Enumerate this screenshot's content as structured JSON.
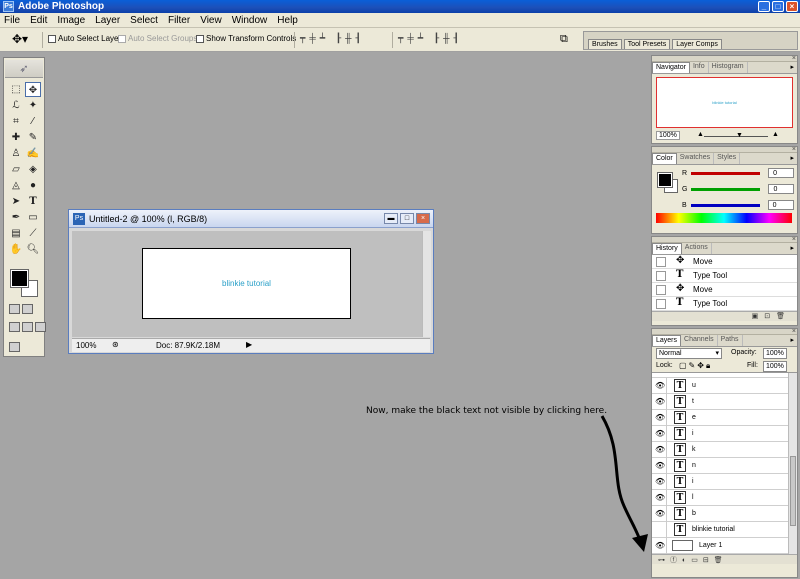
{
  "app": {
    "title": "Adobe Photoshop"
  },
  "menu": [
    "File",
    "Edit",
    "Image",
    "Layer",
    "Select",
    "Filter",
    "View",
    "Window",
    "Help"
  ],
  "options": {
    "auto_select_layer": "Auto Select Layer",
    "auto_select_groups": "Auto Select Groups",
    "show_transform_controls": "Show Transform Controls"
  },
  "well_tabs": [
    "Brushes",
    "Tool Presets",
    "Layer Comps"
  ],
  "document": {
    "title": "Untitled-2 @ 100% (l, RGB/8)",
    "canvas_text": "blinkie tutorial",
    "zoom": "100%",
    "doc_size": "Doc: 87.9K/2.18M"
  },
  "navigator": {
    "tabs": [
      "Navigator",
      "Info",
      "Histogram"
    ],
    "preview_text": "blinkie tutorial",
    "zoom": "100%"
  },
  "color": {
    "tabs": [
      "Color",
      "Swatches",
      "Styles"
    ],
    "channels": [
      {
        "label": "R",
        "value": "0",
        "bar": "#c00000"
      },
      {
        "label": "G",
        "value": "0",
        "bar": "#00a000"
      },
      {
        "label": "B",
        "value": "0",
        "bar": "#0000c0"
      }
    ]
  },
  "history": {
    "tabs": [
      "History",
      "Actions"
    ],
    "items": [
      {
        "icon": "move-icon",
        "label": "Move"
      },
      {
        "icon": "type-tool-icon",
        "label": "Type Tool"
      },
      {
        "icon": "move-icon",
        "label": "Move"
      },
      {
        "icon": "type-tool-icon",
        "label": "Type Tool"
      }
    ]
  },
  "layers": {
    "tabs": [
      "Layers",
      "Channels",
      "Paths"
    ],
    "blend_mode": "Normal",
    "opacity_label": "Opacity:",
    "opacity": "100%",
    "lock_label": "Lock:",
    "fill_label": "Fill:",
    "fill": "100%",
    "items": [
      "u",
      "t",
      "e",
      "i",
      "k",
      "n",
      "i",
      "l",
      "b",
      "blinkie tutorial",
      "Layer 1"
    ]
  },
  "annotation": "Now, make the black text not visible by clicking here."
}
